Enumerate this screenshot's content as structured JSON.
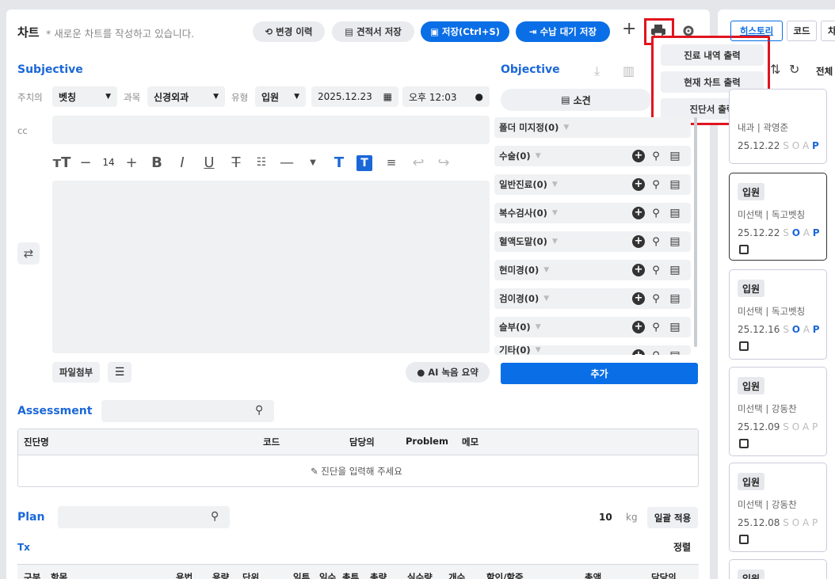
{
  "header": {
    "title": "차트",
    "subtitle": "* 새로운 차트를 작성하고 있습니다.",
    "history": "변경 이력",
    "estimate": "견적서 저장",
    "save": "저장(Ctrl+S)",
    "wait": "수납 대기 저장",
    "plus": "+"
  },
  "print_menu": {
    "items": [
      "진료 내역 출력",
      "현재 차트 출력",
      "진단서 출력"
    ]
  },
  "subjective": {
    "title": "Subjective",
    "doctor_label": "주치의",
    "doctor": "벳칭",
    "dept_label": "과목",
    "dept": "신경외과",
    "type_label": "유형",
    "type": "입원",
    "date": "2025.12.23",
    "time": "오후 12:03",
    "cc_label": "cc",
    "font_size": "14",
    "attach": "파일첨부",
    "ai": "AI 녹음 요약"
  },
  "objective": {
    "title": "Objective",
    "findings": "소견",
    "add": "추가",
    "categories": [
      {
        "name": "폴더 미지정(0)"
      },
      {
        "name": "수술(0)"
      },
      {
        "name": "일반진료(0)"
      },
      {
        "name": "복수검사(0)"
      },
      {
        "name": "혈액도말(0)"
      },
      {
        "name": "현미경(0)"
      },
      {
        "name": "검이경(0)"
      },
      {
        "name": "슬부(0)"
      },
      {
        "name": "기타(0)"
      }
    ]
  },
  "assessment": {
    "title": "Assessment",
    "columns": [
      "진단명",
      "코드",
      "담당의",
      "Problem",
      "메모"
    ],
    "empty": "진단을 입력해 주세요"
  },
  "plan": {
    "title": "Plan",
    "weight": "10",
    "unit": "kg",
    "bulk": "일괄 적용",
    "tx": "Tx",
    "sort": "정렬",
    "columns": [
      "구분",
      "항목",
      "용법",
      "용량",
      "단위",
      "일투",
      "일수",
      "총투",
      "총량",
      "실수량",
      "개수",
      "할인/할증",
      "총액",
      "담당의"
    ]
  },
  "history": {
    "tabs": [
      "히스토리",
      "코드",
      "차"
    ],
    "all": "전체",
    "cards": [
      {
        "badge": "",
        "who": "내과 | 곽영준",
        "date": "25.12.22",
        "sel": "P"
      },
      {
        "badge": "입원",
        "who": "미선택 | 독고벳칭",
        "date": "25.12.22",
        "sel": "O,P"
      },
      {
        "badge": "입원",
        "who": "미선택 | 독고벳칭",
        "date": "25.12.16",
        "sel": "O,P"
      },
      {
        "badge": "입원",
        "who": "미선택 | 강동찬",
        "date": "25.12.09",
        "sel": ""
      },
      {
        "badge": "입원",
        "who": "미선택 | 강동찬",
        "date": "25.12.08",
        "sel": ""
      },
      {
        "badge": "입원",
        "who": "",
        "date": "",
        "sel": ""
      }
    ]
  },
  "colors": {
    "accent": "#0a6ee6",
    "highlight": "#e0141e"
  }
}
